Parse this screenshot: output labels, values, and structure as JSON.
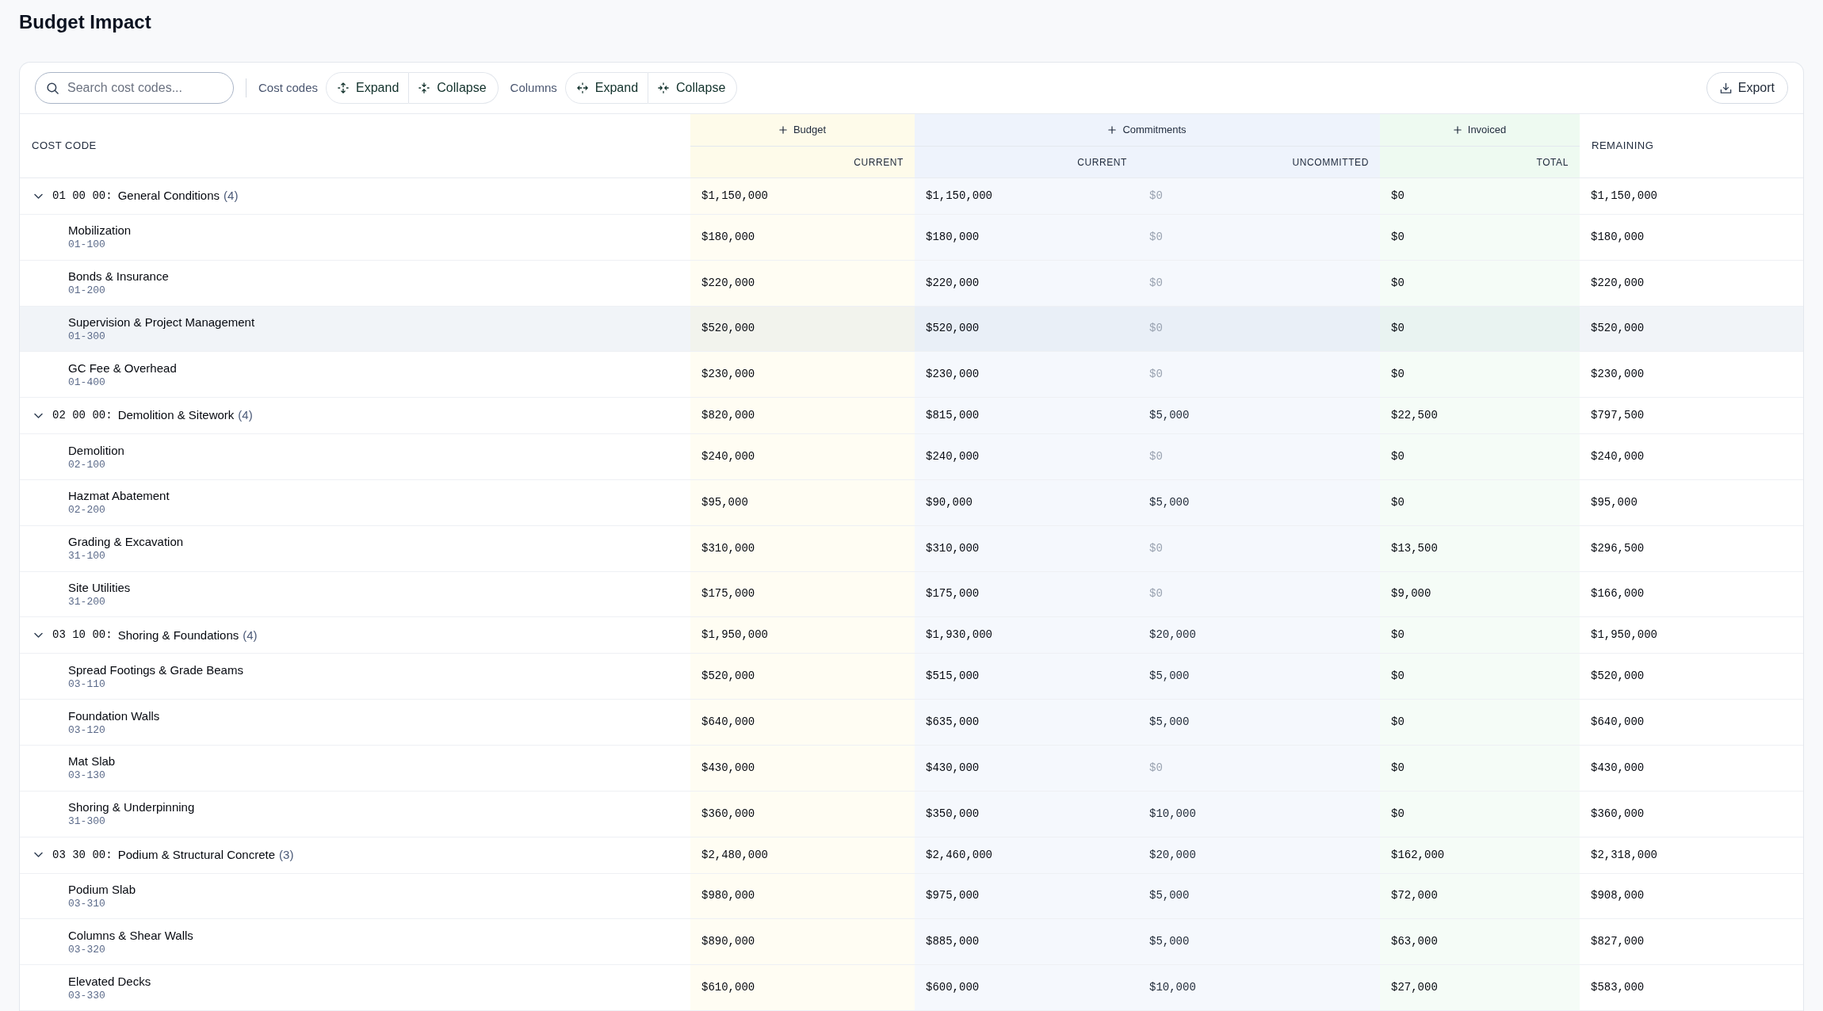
{
  "title": "Budget Impact",
  "toolbar": {
    "search": {
      "placeholder": "Search cost codes..."
    },
    "groups": [
      {
        "label": "Cost codes",
        "buttons": [
          {
            "label": "Expand",
            "kind": "expand_rows"
          },
          {
            "label": "Collapse",
            "kind": "collapse_rows"
          }
        ]
      },
      {
        "label": "Columns",
        "buttons": [
          {
            "label": "Expand",
            "kind": "expand_columns"
          },
          {
            "label": "Collapse",
            "kind": "collapse_columns"
          }
        ]
      }
    ],
    "export": {
      "label": "Export"
    }
  },
  "table": {
    "columns": {
      "cost_code": "COST CODE",
      "groups": [
        {
          "label": "Budget",
          "kind": "budget",
          "subcolumns": [
            "CURRENT"
          ]
        },
        {
          "label": "Commitments",
          "kind": "commitments",
          "subcolumns": [
            "CURRENT",
            "UNCOMMITTED"
          ]
        },
        {
          "label": "Invoiced",
          "kind": "invoiced",
          "subcolumns": [
            "TOTAL"
          ]
        }
      ],
      "remaining": "REMAINING"
    },
    "groups": [
      {
        "code": "01 00 00:",
        "name": "General Conditions",
        "count": "(4)",
        "expanded": true,
        "budget_current": "$1,150,000",
        "committed": "$1,150,000",
        "uncommitted": {
          "text": "$0",
          "muted": true
        },
        "invoiced": "$0",
        "remaining": "$1,150,000",
        "children": [
          {
            "name": "Mobilization",
            "code": "01-100",
            "selected": false,
            "budget_current": "$180,000",
            "committed": "$180,000",
            "uncommitted": {
              "text": "$0",
              "muted": true
            },
            "invoiced": "$0",
            "remaining": "$180,000"
          },
          {
            "name": "Bonds & Insurance",
            "code": "01-200",
            "selected": false,
            "budget_current": "$220,000",
            "committed": "$220,000",
            "uncommitted": {
              "text": "$0",
              "muted": true
            },
            "invoiced": "$0",
            "remaining": "$220,000"
          },
          {
            "name": "Supervision & Project Management",
            "code": "01-300",
            "selected": true,
            "budget_current": "$520,000",
            "committed": "$520,000",
            "uncommitted": {
              "text": "$0",
              "muted": true
            },
            "invoiced": "$0",
            "remaining": "$520,000"
          },
          {
            "name": "GC Fee & Overhead",
            "code": "01-400",
            "selected": false,
            "budget_current": "$230,000",
            "committed": "$230,000",
            "uncommitted": {
              "text": "$0",
              "muted": true
            },
            "invoiced": "$0",
            "remaining": "$230,000"
          }
        ]
      },
      {
        "code": "02 00 00:",
        "name": "Demolition & Sitework",
        "count": "(4)",
        "expanded": true,
        "budget_current": "$820,000",
        "committed": "$815,000",
        "uncommitted": {
          "text": "$5,000",
          "muted": false
        },
        "invoiced": "$22,500",
        "remaining": "$797,500",
        "children": [
          {
            "name": "Demolition",
            "code": "02-100",
            "selected": false,
            "budget_current": "$240,000",
            "committed": "$240,000",
            "uncommitted": {
              "text": "$0",
              "muted": true
            },
            "invoiced": "$0",
            "remaining": "$240,000"
          },
          {
            "name": "Hazmat Abatement",
            "code": "02-200",
            "selected": false,
            "budget_current": "$95,000",
            "committed": "$90,000",
            "uncommitted": {
              "text": "$5,000",
              "muted": false
            },
            "invoiced": "$0",
            "remaining": "$95,000"
          },
          {
            "name": "Grading & Excavation",
            "code": "31-100",
            "selected": false,
            "budget_current": "$310,000",
            "committed": "$310,000",
            "uncommitted": {
              "text": "$0",
              "muted": true
            },
            "invoiced": "$13,500",
            "remaining": "$296,500"
          },
          {
            "name": "Site Utilities",
            "code": "31-200",
            "selected": false,
            "budget_current": "$175,000",
            "committed": "$175,000",
            "uncommitted": {
              "text": "$0",
              "muted": true
            },
            "invoiced": "$9,000",
            "remaining": "$166,000"
          }
        ]
      },
      {
        "code": "03 10 00:",
        "name": "Shoring & Foundations",
        "count": "(4)",
        "expanded": true,
        "budget_current": "$1,950,000",
        "committed": "$1,930,000",
        "uncommitted": {
          "text": "$20,000",
          "muted": false
        },
        "invoiced": "$0",
        "remaining": "$1,950,000",
        "children": [
          {
            "name": "Spread Footings & Grade Beams",
            "code": "03-110",
            "selected": false,
            "budget_current": "$520,000",
            "committed": "$515,000",
            "uncommitted": {
              "text": "$5,000",
              "muted": false
            },
            "invoiced": "$0",
            "remaining": "$520,000"
          },
          {
            "name": "Foundation Walls",
            "code": "03-120",
            "selected": false,
            "budget_current": "$640,000",
            "committed": "$635,000",
            "uncommitted": {
              "text": "$5,000",
              "muted": false
            },
            "invoiced": "$0",
            "remaining": "$640,000"
          },
          {
            "name": "Mat Slab",
            "code": "03-130",
            "selected": false,
            "budget_current": "$430,000",
            "committed": "$430,000",
            "uncommitted": {
              "text": "$0",
              "muted": true
            },
            "invoiced": "$0",
            "remaining": "$430,000"
          },
          {
            "name": "Shoring & Underpinning",
            "code": "31-300",
            "selected": false,
            "budget_current": "$360,000",
            "committed": "$350,000",
            "uncommitted": {
              "text": "$10,000",
              "muted": false
            },
            "invoiced": "$0",
            "remaining": "$360,000"
          }
        ]
      },
      {
        "code": "03 30 00:",
        "name": "Podium & Structural Concrete",
        "count": "(3)",
        "expanded": true,
        "budget_current": "$2,480,000",
        "committed": "$2,460,000",
        "uncommitted": {
          "text": "$20,000",
          "muted": false
        },
        "invoiced": "$162,000",
        "remaining": "$2,318,000",
        "children": [
          {
            "name": "Podium Slab",
            "code": "03-310",
            "selected": false,
            "budget_current": "$980,000",
            "committed": "$975,000",
            "uncommitted": {
              "text": "$5,000",
              "muted": false
            },
            "invoiced": "$72,000",
            "remaining": "$908,000"
          },
          {
            "name": "Columns & Shear Walls",
            "code": "03-320",
            "selected": false,
            "budget_current": "$890,000",
            "committed": "$885,000",
            "uncommitted": {
              "text": "$5,000",
              "muted": false
            },
            "invoiced": "$63,000",
            "remaining": "$827,000"
          },
          {
            "name": "Elevated Decks",
            "code": "03-330",
            "selected": false,
            "budget_current": "$610,000",
            "committed": "$600,000",
            "uncommitted": {
              "text": "$10,000",
              "muted": false
            },
            "invoiced": "$27,000",
            "remaining": "$583,000"
          }
        ]
      }
    ]
  }
}
